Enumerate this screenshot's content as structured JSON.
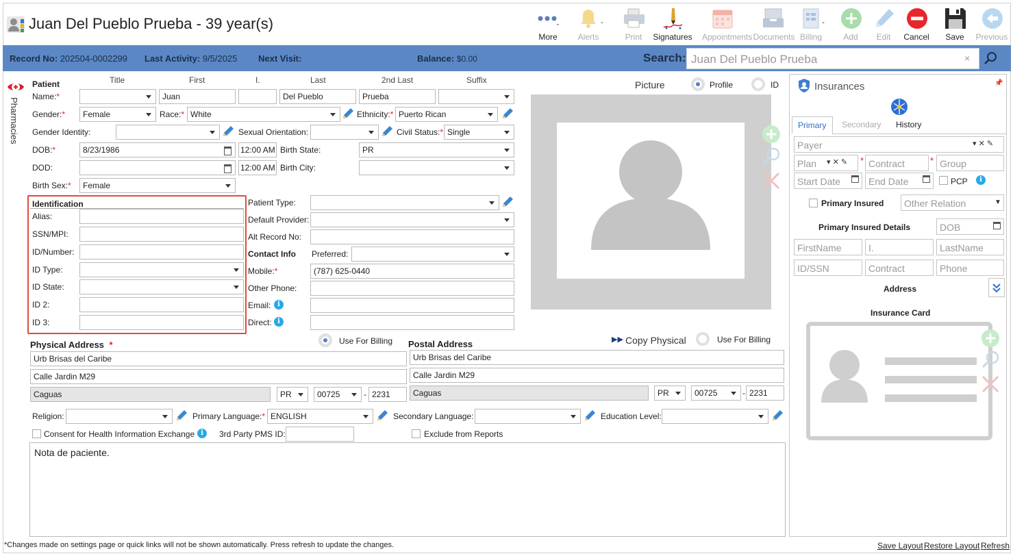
{
  "header": {
    "title": "Juan Del Pueblo Prueba - 39 year(s)",
    "toolbar": [
      {
        "label": "More",
        "icon": "more-dots-icon",
        "enabled": true
      },
      {
        "label": "Alerts",
        "icon": "bell-icon",
        "enabled": false
      },
      {
        "label": "Print",
        "icon": "printer-icon",
        "enabled": false
      },
      {
        "label": "Signatures",
        "icon": "signature-pen-icon",
        "enabled": true
      },
      {
        "label": "Appointments",
        "icon": "calendar-icon",
        "enabled": false
      },
      {
        "label": "Documents",
        "icon": "inbox-tray-icon",
        "enabled": false
      },
      {
        "label": "Billing",
        "icon": "billing-icon",
        "enabled": false
      },
      {
        "label": "Add",
        "icon": "plus-circle-icon",
        "enabled": false
      },
      {
        "label": "Edit",
        "icon": "pencil-icon",
        "enabled": false
      },
      {
        "label": "Cancel",
        "icon": "cancel-circle-icon",
        "enabled": true
      },
      {
        "label": "Save",
        "icon": "floppy-disk-icon",
        "enabled": true
      },
      {
        "label": "Previous",
        "icon": "arrow-left-circle-icon",
        "enabled": false
      }
    ]
  },
  "infobar": {
    "record_label": "Record No:",
    "record_value": "202504-0002299",
    "activity_label": "Last Activity:",
    "activity_value": "9/5/2025",
    "next_label": "Next Visit:",
    "next_value": "",
    "balance_label": "Balance:",
    "balance_value": "$0.00",
    "search_label": "Search:",
    "search_value": "Juan Del Pueblo Prueba",
    "search_clear": "×"
  },
  "side_tab": "Pharmacies",
  "patient": {
    "section": "Patient",
    "col_title": "Title",
    "col_first": "First",
    "col_i": "I.",
    "col_last": "Last",
    "col_2nd": "2nd Last",
    "col_suffix": "Suffix",
    "name_label": "Name:",
    "title": "",
    "first": "Juan",
    "initial": "",
    "last": "Del Pueblo",
    "second_last": "Prueba",
    "suffix": "",
    "gender_label": "Gender:",
    "gender": "Female",
    "race_label": "Race:",
    "race": "White",
    "ethnicity_label": "Ethnicity:",
    "ethnicity": "Puerto Rican",
    "gender_identity_label": "Gender Identity:",
    "gender_identity": "",
    "sexual_orientation_label": "Sexual Orientation:",
    "sexual_orientation": "",
    "civil_status_label": "Civil Status:",
    "civil_status": "Single",
    "dob_label": "DOB:",
    "dob": "8/23/1986",
    "dob_time": "12:00 AM",
    "birth_state_label": "Birth State:",
    "birth_state": "PR",
    "dod_label": "DOD:",
    "dod": "",
    "dod_time": "12:00 AM",
    "birth_city_label": "Birth City:",
    "birth_city": "",
    "birth_sex_label": "Birth Sex:",
    "birth_sex": "Female"
  },
  "identification": {
    "section": "Identification",
    "alias_label": "Alias:",
    "alias": "",
    "ssn_label": "SSN/MPI:",
    "ssn": "",
    "idnum_label": "ID/Number:",
    "idnum": "",
    "idtype_label": "ID Type:",
    "idtype": "",
    "idstate_label": "ID State:",
    "idstate": "",
    "id2_label": "ID 2:",
    "id2": "",
    "id3_label": "ID 3:",
    "id3": ""
  },
  "details": {
    "patient_type_label": "Patient Type:",
    "patient_type": "",
    "default_provider_label": "Default Provider:",
    "default_provider": "",
    "alt_record_label": "Alt Record No:",
    "alt_record": "",
    "contact_section": "Contact Info",
    "preferred_label": "Preferred:",
    "preferred": "",
    "mobile_label": "Mobile:",
    "mobile": "(787) 625-0440",
    "other_phone_label": "Other Phone:",
    "other_phone": "",
    "email_label": "Email:",
    "email": "",
    "direct_label": "Direct:",
    "direct": ""
  },
  "picture": {
    "label": "Picture",
    "profile_label": "Profile",
    "id_label": "ID"
  },
  "physical": {
    "title": "Physical Address",
    "use_billing": "Use For Billing",
    "line1": "Urb Brisas del Caribe",
    "line2": "Calle Jardin M29",
    "city": "Caguas",
    "state": "PR",
    "zip": "00725",
    "zip4": "2231"
  },
  "postal": {
    "title": "Postal Address",
    "copy": "Copy Physical",
    "use_billing": "Use For Billing",
    "line1": "Urb Brisas del Caribe",
    "line2": "Calle Jardin M29",
    "city": "Caguas",
    "state": "PR",
    "zip": "00725",
    "zip4": "2231"
  },
  "misc": {
    "religion_label": "Religion:",
    "religion": "",
    "primary_lang_label": "Primary Language:",
    "primary_lang": "ENGLISH",
    "secondary_lang_label": "Secondary Language:",
    "secondary_lang": "",
    "education_label": "Education Level:",
    "education": "",
    "consent_label": "Consent for Health Information Exchange",
    "pms_label": "3rd Party PMS ID:",
    "pms": "",
    "exclude_label": "Exclude from Reports"
  },
  "note": "Nota de paciente.",
  "footer": {
    "message": "*Changes made on settings page or quick links will not be shown automatically. Press refresh to update the changes.",
    "save_layout": "Save Layout",
    "restore_layout": "Restore Layout",
    "refresh": "Refresh"
  },
  "insurance": {
    "title": "Insurances",
    "tabs": [
      "Primary",
      "Secondary",
      "History"
    ],
    "payer": "Payer",
    "plan": "Plan",
    "contract": "Contract",
    "group": "Group",
    "start_date": "Start Date",
    "end_date": "End Date",
    "pcp": "PCP",
    "primary_insured": "Primary Insured",
    "other_relation": "Other Relation",
    "details_title": "Primary Insured Details",
    "dob": "DOB",
    "firstname": "FirstName",
    "initial": "I.",
    "lastname": "LastName",
    "idssn": "ID/SSN",
    "contract2": "Contract",
    "phone": "Phone",
    "address": "Address",
    "card": "Insurance Card"
  }
}
